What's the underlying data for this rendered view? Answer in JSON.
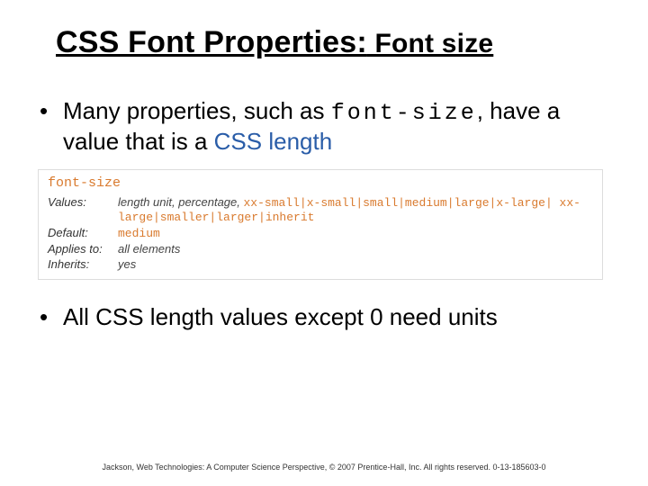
{
  "title": {
    "main": "CSS Font Properties:",
    "sub": " Font size"
  },
  "bullet1": {
    "pre": "Many properties, such as ",
    "code": "font-size",
    "mid": ", have a value that is a ",
    "link": "CSS length"
  },
  "spec": {
    "property": "font-size",
    "rows": {
      "values": {
        "label": "Values:",
        "lead": "length unit, percentage, ",
        "kw": "xx-small|x-small|small|medium|large|x-large| xx-large|smaller|larger|inherit"
      },
      "default": {
        "label": "Default:",
        "kw": "medium"
      },
      "applies": {
        "label": "Applies to:",
        "val": "all elements"
      },
      "inherits": {
        "label": "Inherits:",
        "val": "yes"
      }
    }
  },
  "bullet2": "All CSS length values except 0 need units",
  "footer": "Jackson, Web Technologies: A Computer Science Perspective, © 2007 Prentice-Hall, Inc. All rights reserved. 0-13-185603-0"
}
